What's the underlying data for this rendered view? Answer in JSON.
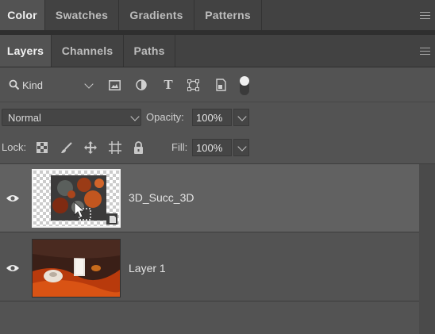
{
  "top_tabs": [
    "Color",
    "Swatches",
    "Gradients",
    "Patterns"
  ],
  "panel_tabs": [
    "Layers",
    "Channels",
    "Paths"
  ],
  "filter": {
    "kind_label": "Kind"
  },
  "blend": {
    "mode": "Normal",
    "opacity_label": "Opacity:",
    "opacity_value": "100%"
  },
  "lock": {
    "lock_label": "Lock:",
    "fill_label": "Fill:",
    "fill_value": "100%"
  },
  "layers": [
    {
      "name": "3D_Succ_3D",
      "selected": true,
      "visible": true
    },
    {
      "name": "Layer 1",
      "selected": false,
      "visible": true
    }
  ]
}
